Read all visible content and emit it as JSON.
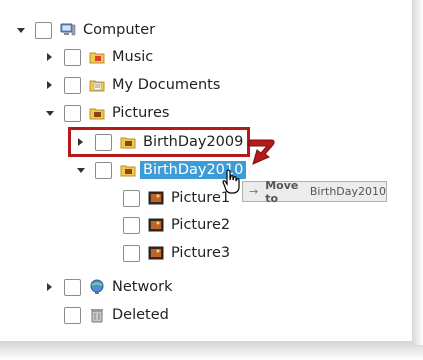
{
  "tree": {
    "computer": "Computer",
    "music": "Music",
    "my_documents": "My Documents",
    "pictures": "Pictures",
    "birthday2009": "BirthDay2009",
    "birthday2010": "BirthDay2010",
    "picture1": "Picture1",
    "picture2": "Picture2",
    "picture3": "Picture3",
    "network": "Network",
    "deleted": "Deleted"
  },
  "drag_tooltip": {
    "arrow": "→",
    "action": "Move to",
    "target": "BirthDay2010"
  },
  "colors": {
    "selection": "#3d9bd6",
    "highlight_box": "#b51a1a"
  }
}
